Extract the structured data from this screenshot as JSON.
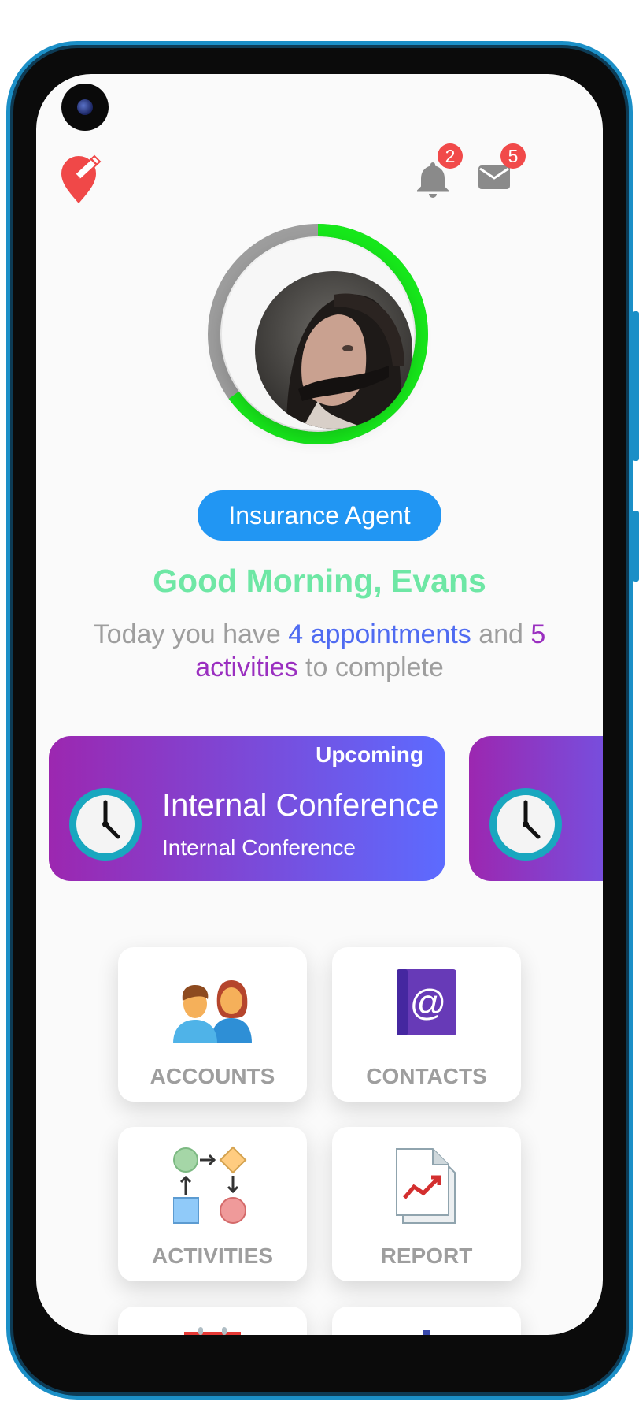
{
  "header": {
    "notifications_count": "2",
    "messages_count": "5"
  },
  "profile": {
    "role": "Insurance Agent",
    "greeting": "Good Morning, Evans",
    "progress": 0.65,
    "progress_color": "#17e81b",
    "track_color": "#9e9e9e"
  },
  "summary": {
    "prefix": "Today you have ",
    "appointments": "4 appointments",
    "middle": " and ",
    "activities": "5 activities",
    "suffix": " to complete"
  },
  "events": [
    {
      "status": "Upcoming",
      "title": "Internal Conference",
      "subtitle": "Internal Conference",
      "icon": "clock-icon"
    }
  ],
  "menu": [
    {
      "label": "ACCOUNTS",
      "icon": "accounts-icon"
    },
    {
      "label": "CONTACTS",
      "icon": "contacts-icon"
    },
    {
      "label": "ACTIVITIES",
      "icon": "activities-icon"
    },
    {
      "label": "REPORT",
      "icon": "report-icon"
    }
  ],
  "colors": {
    "accent_blue": "#2196f3",
    "greeting_green": "#6ee7a5",
    "appointments_blue": "#4f6bf1",
    "activities_purple": "#9a2fc0",
    "badge_red": "#f14a4a",
    "logo_red": "#f04848"
  }
}
